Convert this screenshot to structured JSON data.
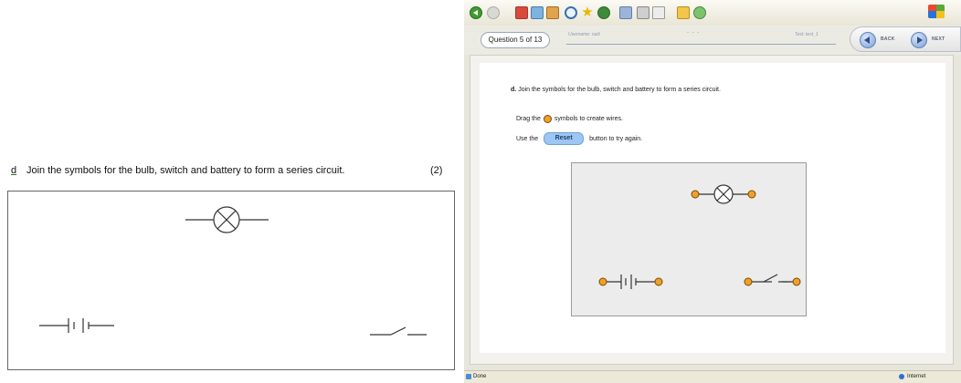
{
  "paper": {
    "letter": "d",
    "question": "Join the symbols for the bulb, switch and battery to form a series  circuit.",
    "marks": "(2)"
  },
  "browser": {
    "toolbar_icons": [
      "back-icon",
      "forward-icon",
      "stop-icon",
      "refresh-icon",
      "home-icon",
      "search-icon",
      "favorites-icon",
      "history-icon",
      "mail-icon",
      "print-icon",
      "edit-icon",
      "folder-icon",
      "messenger-icon",
      "windows-logo-icon"
    ],
    "tab": "Question 5 of 13",
    "username": "Username: nuiii",
    "dots": "- - -",
    "test_name": "Test: test_1",
    "back_label": "BACK",
    "next_label": "NEXT",
    "status_left": "Done",
    "status_zone": "Internet"
  },
  "question": {
    "label": "d.",
    "text": "Join the symbols for the bulb, switch and battery to form a series circuit.",
    "drag_prefix": "Drag the",
    "drag_suffix": "symbols to create wires.",
    "use_prefix": "Use the",
    "reset_label": "Reset",
    "use_suffix": "button to try again."
  },
  "colors": {
    "connector_fill": "#f0a029",
    "connector_stroke": "#7a4a00",
    "reset_button": "#9cc6f3"
  }
}
